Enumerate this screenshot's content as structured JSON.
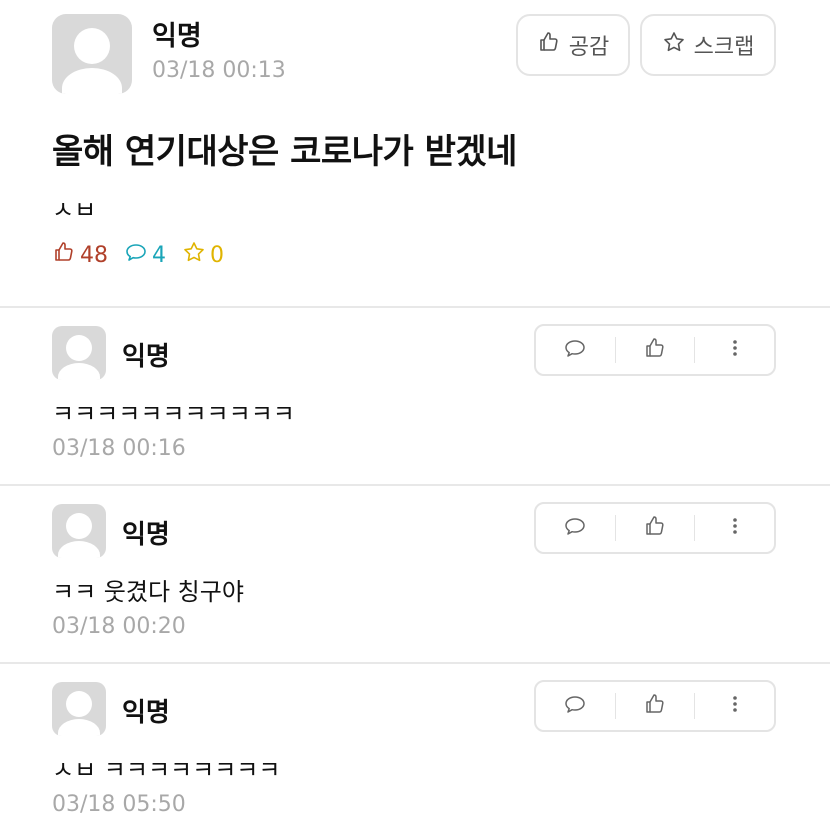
{
  "post": {
    "author": "익명",
    "date": "03/18 00:13",
    "like_button_label": "공감",
    "scrap_button_label": "스크랩",
    "title": "올해 연기대상은 코로나가 받겠네",
    "content": "ㅅㅂ",
    "stats": {
      "likes": "48",
      "comments": "4",
      "scraps": "0"
    },
    "colors": {
      "like": "#b0402a",
      "comment": "#1aa5b8",
      "scrap": "#e0b400"
    }
  },
  "comments": [
    {
      "author": "익명",
      "text": "ㅋㅋㅋㅋㅋㅋㅋㅋㅋㅋㅋ",
      "time": "03/18 00:16"
    },
    {
      "author": "익명",
      "text": "ㅋㅋ 웃겼다 칭구야",
      "time": "03/18 00:20"
    },
    {
      "author": "익명",
      "text": "ㅅㅂ ㅋㅋㅋㅋㅋㅋㅋㅋ",
      "time": "03/18 05:50"
    }
  ]
}
